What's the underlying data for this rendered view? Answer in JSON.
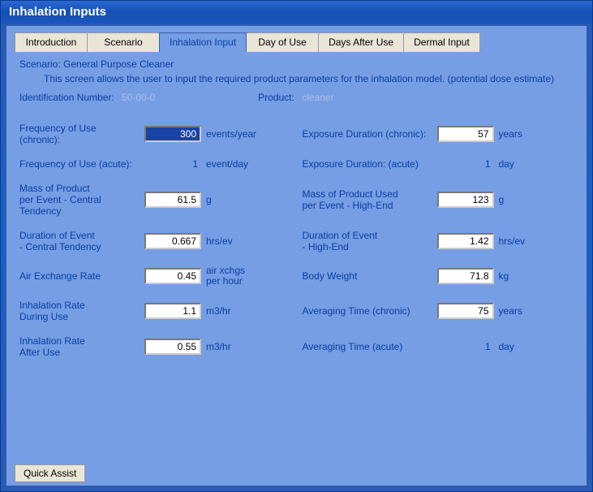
{
  "window": {
    "title": "Inhalation Inputs"
  },
  "tabs": {
    "intro": "Introduction",
    "scenario": "Scenario",
    "inhal": "Inhalation Input",
    "day": "Day of Use",
    "after": "Days After Use",
    "dermal": "Dermal Input"
  },
  "scenario_label": "Scenario: General Purpose Cleaner",
  "help_text": "This screen allows the user to input the required product parameters for the inhalation model. (potential dose estimate)",
  "ident": {
    "label_id_num": "Identification Number:",
    "id_num": "50-00-0",
    "label_product": "Product:",
    "product": "cleaner"
  },
  "rows": {
    "r1": {
      "l": "Frequency of Use (chronic):",
      "v": "300",
      "u": "events/year"
    },
    "r1b": {
      "l": "Exposure Duration (chronic):",
      "v": "57",
      "u": "years"
    },
    "r2": {
      "l": "Frequency of Use (acute):",
      "v": "1",
      "u": "event/day"
    },
    "r2b": {
      "l": "Exposure Duration:   (acute)",
      "v": "1",
      "u": "day"
    },
    "r3": {
      "l": "Mass of Product\nper Event - Central Tendency",
      "v": "61.5",
      "u": "g"
    },
    "r3b": {
      "l": "Mass of Product Used\nper Event - High-End",
      "v": "123",
      "u": "g"
    },
    "r4": {
      "l": "Duration of Event\n   - Central Tendency",
      "v": "0.667",
      "u": "hrs/ev"
    },
    "r4b": {
      "l": "Duration of Event\n   - High-End",
      "v": "1.42",
      "u": "hrs/ev"
    },
    "r5": {
      "l": "Air Exchange Rate",
      "v": "0.45",
      "u": "air xchgs\nper hour"
    },
    "r5b": {
      "l": "Body Weight",
      "v": "71.8",
      "u": "kg"
    },
    "r6": {
      "l": "Inhalation Rate\n   During Use",
      "v": "1.1",
      "u": "m3/hr"
    },
    "r6b": {
      "l": "Averaging Time (chronic)",
      "v": "75",
      "u": "years"
    },
    "r7": {
      "l": "Inhalation Rate\n   After Use",
      "v": "0.55",
      "u": "m3/hr"
    },
    "r7b": {
      "l": "Averaging Time (acute)",
      "v": "1",
      "u": "day"
    }
  },
  "quick_assist": "Quick Assist"
}
